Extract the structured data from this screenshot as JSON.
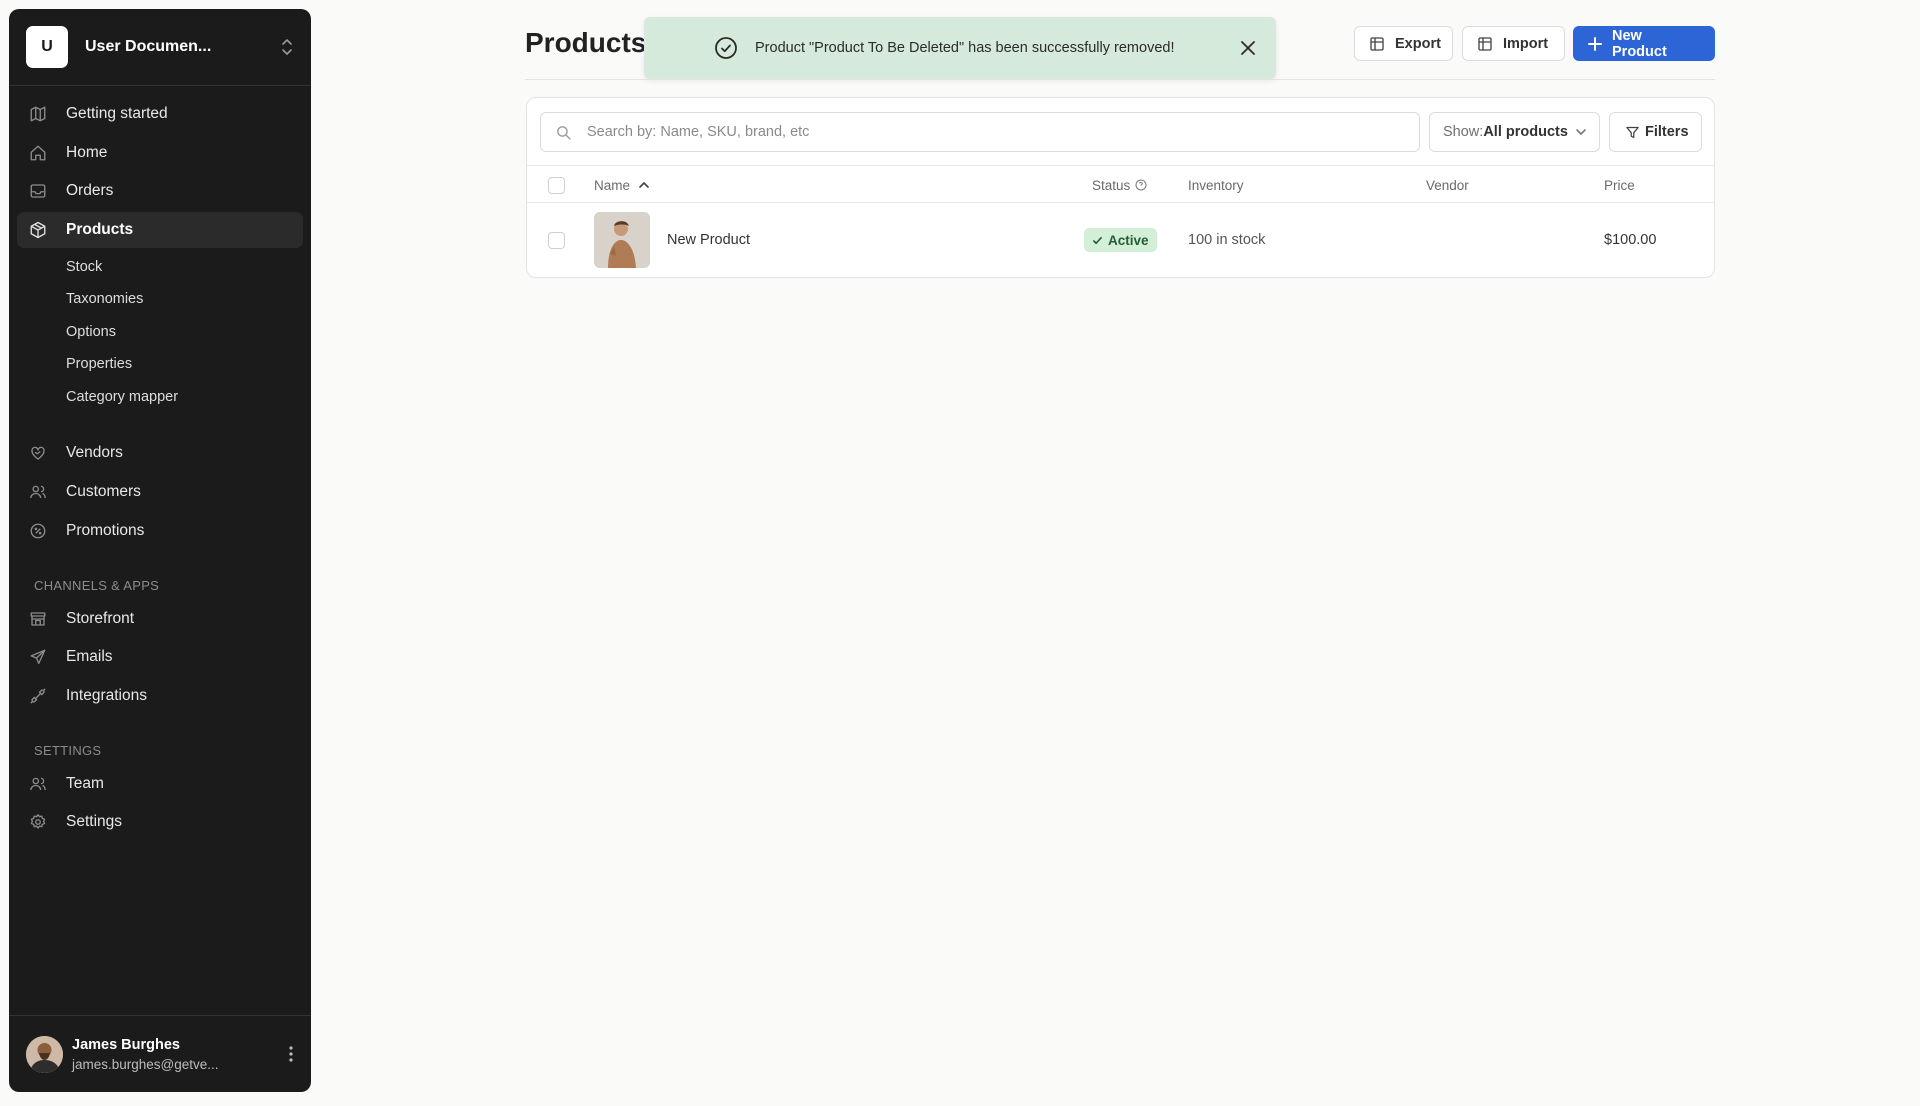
{
  "store": {
    "initial": "U",
    "name": "User Documen..."
  },
  "nav": {
    "items": [
      {
        "label": "Getting started",
        "icon": "map-icon"
      },
      {
        "label": "Home",
        "icon": "home-icon"
      },
      {
        "label": "Orders",
        "icon": "inbox-icon"
      },
      {
        "label": "Products",
        "icon": "box-icon",
        "active": true
      }
    ],
    "product_sub": [
      "Stock",
      "Taxonomies",
      "Options",
      "Properties",
      "Category mapper"
    ],
    "items2": [
      {
        "label": "Vendors",
        "icon": "heart-handshake-icon"
      },
      {
        "label": "Customers",
        "icon": "users-icon"
      },
      {
        "label": "Promotions",
        "icon": "discount-icon"
      }
    ],
    "channels_title": "CHANNELS & APPS",
    "channels": [
      {
        "label": "Storefront",
        "icon": "store-icon"
      },
      {
        "label": "Emails",
        "icon": "send-icon"
      },
      {
        "label": "Integrations",
        "icon": "plug-icon"
      }
    ],
    "settings_title": "SETTINGS",
    "settings": [
      {
        "label": "Team",
        "icon": "users-icon"
      },
      {
        "label": "Settings",
        "icon": "gear-icon"
      }
    ]
  },
  "user": {
    "name": "James Burghes",
    "email": "james.burghes@getve..."
  },
  "page": {
    "title": "Products"
  },
  "toast": {
    "message": "Product \"Product To Be Deleted\" has been successfully removed!"
  },
  "actions": {
    "export": "Export",
    "import": "Import",
    "new_product": "New Product"
  },
  "search": {
    "placeholder": "Search by: Name, SKU, brand, etc"
  },
  "filter": {
    "show_label": "Show:",
    "show_value": "All products",
    "filters": "Filters"
  },
  "table": {
    "headers": {
      "name": "Name",
      "status": "Status",
      "inventory": "Inventory",
      "vendor": "Vendor",
      "price": "Price"
    },
    "rows": [
      {
        "name": "New Product",
        "status": "Active",
        "inventory": "100 in stock",
        "vendor": "",
        "price": "$100.00"
      }
    ]
  },
  "colors": {
    "primary": "#2d65d6",
    "sidebar": "#1b1b1b",
    "toast_bg": "#d6eadb",
    "active_badge": "#d3efd8"
  }
}
